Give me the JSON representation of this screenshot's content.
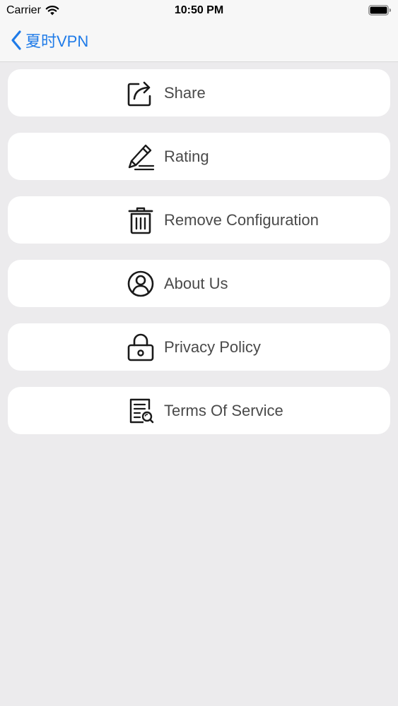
{
  "status_bar": {
    "carrier": "Carrier",
    "time": "10:50 PM"
  },
  "nav": {
    "back_label": "夏时VPN",
    "accent_color": "#1F7BE8"
  },
  "menu": {
    "items": [
      {
        "label": "Share",
        "icon": "share-icon"
      },
      {
        "label": "Rating",
        "icon": "pencil-icon"
      },
      {
        "label": "Remove Configuration",
        "icon": "trash-icon"
      },
      {
        "label": "About Us",
        "icon": "user-icon"
      },
      {
        "label": "Privacy Policy",
        "icon": "lock-icon"
      },
      {
        "label": "Terms Of Service",
        "icon": "document-search-icon"
      }
    ]
  }
}
